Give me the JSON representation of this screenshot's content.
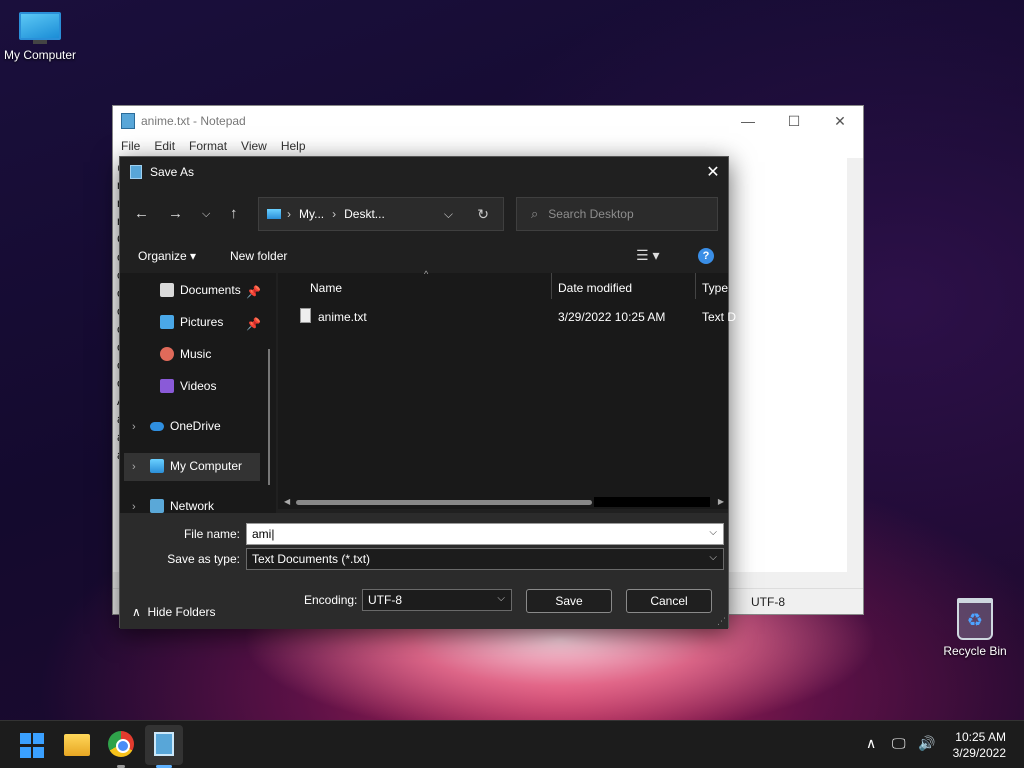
{
  "desktop": {
    "my_computer": "My Computer",
    "recycle_bin": "Recycle Bin"
  },
  "notepad": {
    "title": "anime.txt - Notepad",
    "menu": [
      "File",
      "Edit",
      "Format",
      "View",
      "Help"
    ],
    "visible_chars": [
      "@",
      "n",
      "n",
      "n",
      "C",
      "c",
      "c",
      "c",
      "c",
      "c",
      "c",
      "c",
      "c",
      "A",
      "a",
      "a",
      "a"
    ],
    "status_encoding": "UTF-8"
  },
  "dialog": {
    "title": "Save As",
    "address": {
      "part1": "My...",
      "part2": "Deskt..."
    },
    "search_placeholder": "Search Desktop",
    "toolbar": {
      "organize": "Organize",
      "new_folder": "New folder",
      "help": "?"
    },
    "nav": {
      "documents": "Documents",
      "pictures": "Pictures",
      "music": "Music",
      "videos": "Videos",
      "onedrive": "OneDrive",
      "my_computer": "My Computer",
      "network": "Network"
    },
    "columns": {
      "name": "Name",
      "date": "Date modified",
      "type": "Type"
    },
    "files": [
      {
        "name": "anime.txt",
        "date": "3/29/2022 10:25 AM",
        "type": "Text D"
      }
    ],
    "file_name_label": "File name:",
    "file_name_value": "ami",
    "save_type_label": "Save as type:",
    "save_type_value": "Text Documents (*.txt)",
    "hide_folders": "Hide Folders",
    "encoding_label": "Encoding:",
    "encoding_value": "UTF-8",
    "save": "Save",
    "cancel": "Cancel"
  },
  "taskbar": {
    "time": "10:25 AM",
    "date": "3/29/2022"
  }
}
